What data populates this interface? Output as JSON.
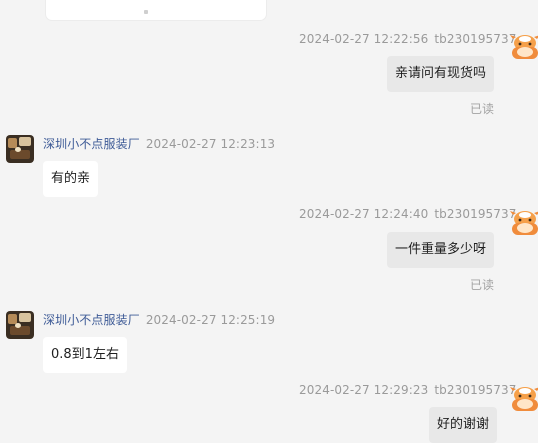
{
  "messages": [
    {
      "direction": "out",
      "timestamp": "2024-02-27 12:22:56",
      "sender": "tb230195737",
      "text": "亲请问有现货吗",
      "status": "已读",
      "avatar": "orange-cow-avatar"
    },
    {
      "direction": "in",
      "sender": "深圳小不点服装厂",
      "timestamp": "2024-02-27 12:23:13",
      "text": "有的亲",
      "avatar": "shop-avatar"
    },
    {
      "direction": "out",
      "timestamp": "2024-02-27 12:24:40",
      "sender": "tb230195737",
      "text": "一件重量多少呀",
      "status": "已读",
      "avatar": "orange-cow-avatar"
    },
    {
      "direction": "in",
      "sender": "深圳小不点服装厂",
      "timestamp": "2024-02-27 12:25:19",
      "text": "0.8到1左右",
      "avatar": "shop-avatar"
    },
    {
      "direction": "out",
      "timestamp": "2024-02-27 12:29:23",
      "sender": "tb230195737",
      "text": "好的谢谢",
      "avatar": "orange-cow-avatar"
    }
  ],
  "colors": {
    "background": "#f4f4f4",
    "incoming_bubble": "#ffffff",
    "outgoing_bubble": "#e8e8e8",
    "sender_name": "#3d5a96",
    "meta_text": "#9a9a9a",
    "cow_orange": "#f08c3c"
  }
}
